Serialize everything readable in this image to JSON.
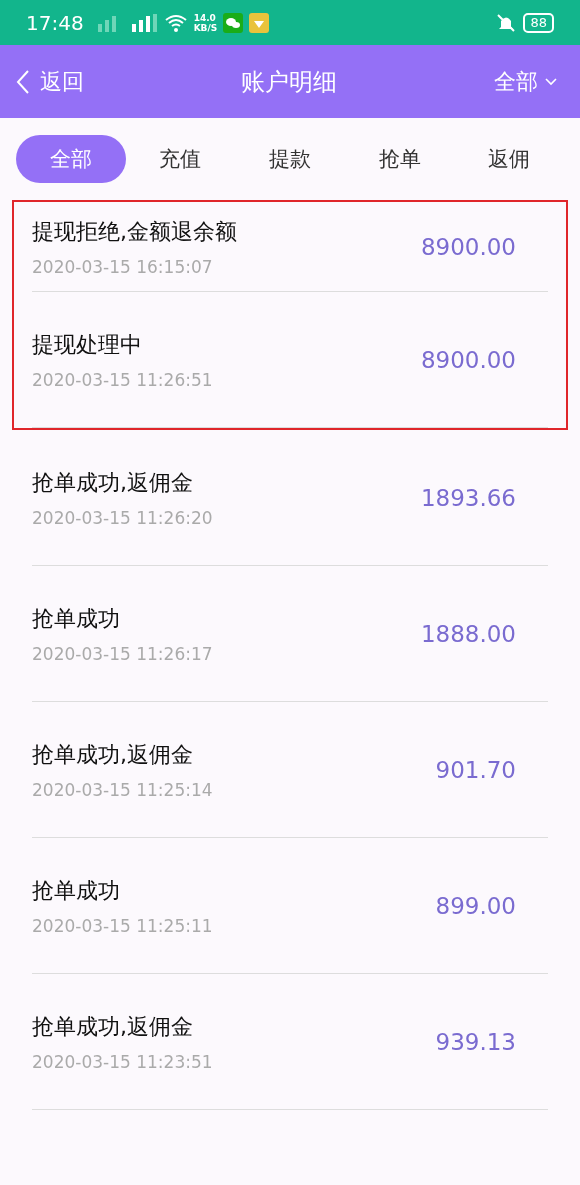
{
  "status_bar": {
    "time": "17:48",
    "net_speed": "14.0",
    "net_unit": "KB/S",
    "battery": "88"
  },
  "header": {
    "back": "返回",
    "title": "账户明细",
    "filter": "全部"
  },
  "tabs": [
    {
      "label": "全部",
      "selected": true
    },
    {
      "label": "充值",
      "selected": false
    },
    {
      "label": "提款",
      "selected": false
    },
    {
      "label": "抢单",
      "selected": false
    },
    {
      "label": "返佣",
      "selected": false
    }
  ],
  "records": [
    {
      "title": "提现拒绝,金额退余额",
      "time": "2020-03-15 16:15:07",
      "amount": "8900.00",
      "marked": true
    },
    {
      "title": "提现处理中",
      "time": "2020-03-15 11:26:51",
      "amount": "8900.00",
      "marked": true
    },
    {
      "title": "抢单成功,返佣金",
      "time": "2020-03-15 11:26:20",
      "amount": "1893.66",
      "marked": false
    },
    {
      "title": "抢单成功",
      "time": "2020-03-15 11:26:17",
      "amount": "1888.00",
      "marked": false
    },
    {
      "title": "抢单成功,返佣金",
      "time": "2020-03-15 11:25:14",
      "amount": "901.70",
      "marked": false
    },
    {
      "title": "抢单成功",
      "time": "2020-03-15 11:25:11",
      "amount": "899.00",
      "marked": false
    },
    {
      "title": "抢单成功,返佣金",
      "time": "2020-03-15 11:23:51",
      "amount": "939.13",
      "marked": false
    }
  ]
}
